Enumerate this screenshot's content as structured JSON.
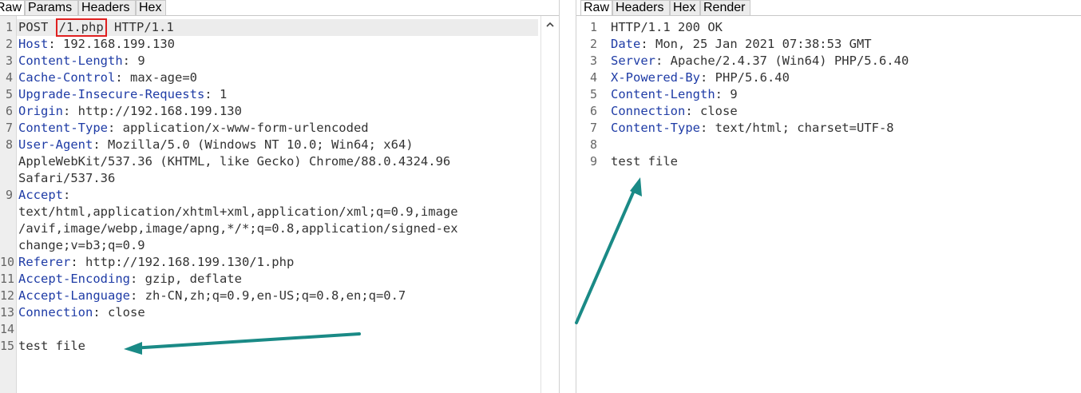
{
  "request": {
    "tabs": [
      "Raw",
      "Params",
      "Headers",
      "Hex"
    ],
    "active_tab": "Raw",
    "lines": [
      {
        "n": "1",
        "method": "POST",
        "path": "/1.php",
        "version": "HTTP/1.1"
      },
      {
        "n": "2",
        "key": "Host",
        "value": "192.168.199.130"
      },
      {
        "n": "3",
        "key": "Content-Length",
        "value": "9"
      },
      {
        "n": "4",
        "key": "Cache-Control",
        "value": "max-age=0"
      },
      {
        "n": "5",
        "key": "Upgrade-Insecure-Requests",
        "value": "1"
      },
      {
        "n": "6",
        "key": "Origin",
        "value": "http://192.168.199.130"
      },
      {
        "n": "7",
        "key": "Content-Type",
        "value": "application/x-www-form-urlencoded"
      },
      {
        "n": "8",
        "key": "User-Agent",
        "value": "Mozilla/5.0 (Windows NT 10.0; Win64; x64)"
      },
      {
        "n": "",
        "text": "AppleWebKit/537.36 (KHTML, like Gecko) Chrome/88.0.4324.96"
      },
      {
        "n": "",
        "text": "Safari/537.36"
      },
      {
        "n": "9",
        "key": "Accept",
        "value": ""
      },
      {
        "n": "",
        "text": "text/html,application/xhtml+xml,application/xml;q=0.9,image"
      },
      {
        "n": "",
        "text": "/avif,image/webp,image/apng,*/*;q=0.8,application/signed-ex"
      },
      {
        "n": "",
        "text": "change;v=b3;q=0.9"
      },
      {
        "n": "10",
        "key": "Referer",
        "value": "http://192.168.199.130/1.php"
      },
      {
        "n": "11",
        "key": "Accept-Encoding",
        "value": "gzip, deflate"
      },
      {
        "n": "12",
        "key": "Accept-Language",
        "value": "zh-CN,zh;q=0.9,en-US;q=0.8,en;q=0.7"
      },
      {
        "n": "13",
        "key": "Connection",
        "value": "close"
      },
      {
        "n": "14",
        "text": ""
      },
      {
        "n": "15",
        "text": "test file"
      }
    ]
  },
  "response": {
    "tabs": [
      "Raw",
      "Headers",
      "Hex",
      "Render"
    ],
    "active_tab": "Raw",
    "lines": [
      {
        "n": "1",
        "text": "HTTP/1.1 200 OK"
      },
      {
        "n": "2",
        "key": "Date",
        "value": "Mon, 25 Jan 2021 07:38:53 GMT"
      },
      {
        "n": "3",
        "key": "Server",
        "value": "Apache/2.4.37 (Win64) PHP/5.6.40"
      },
      {
        "n": "4",
        "key": "X-Powered-By",
        "value": "PHP/5.6.40"
      },
      {
        "n": "5",
        "key": "Content-Length",
        "value": "9"
      },
      {
        "n": "6",
        "key": "Connection",
        "value": "close"
      },
      {
        "n": "7",
        "key": "Content-Type",
        "value": "text/html; charset=UTF-8"
      },
      {
        "n": "8",
        "text": ""
      },
      {
        "n": "9",
        "text": "test file"
      }
    ]
  },
  "colors": {
    "header_key": "#1f3ca6",
    "annotation_arrow": "#1a8a86",
    "highlight_box": "#e02020"
  },
  "icons": {
    "scroll_up": "chevron-up-icon"
  }
}
